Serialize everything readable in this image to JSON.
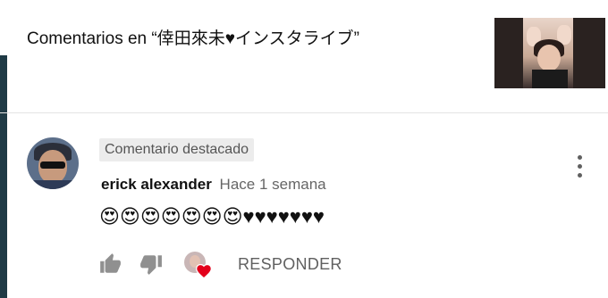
{
  "header": {
    "title": "Comentarios en “倖田來未♥インスタライブ”",
    "thumbnail_icon": "video-thumbnail"
  },
  "comment": {
    "pinned_label": "Comentario destacado",
    "author": "erick alexander",
    "time": "Hace 1 semana",
    "text": "😍😍😍😍😍😍😍♥♥♥♥♥♥♥"
  },
  "actions": {
    "like_icon": "thumbs-up-icon",
    "dislike_icon": "thumbs-down-icon",
    "creator_heart_icon": "creator-heart-icon",
    "reply_label": "RESPONDER"
  },
  "menu_icon": "more-vert-icon",
  "colors": {
    "heart": "#e3001b",
    "icon_gray": "#909090",
    "accent_bar": "#1f3a45"
  }
}
